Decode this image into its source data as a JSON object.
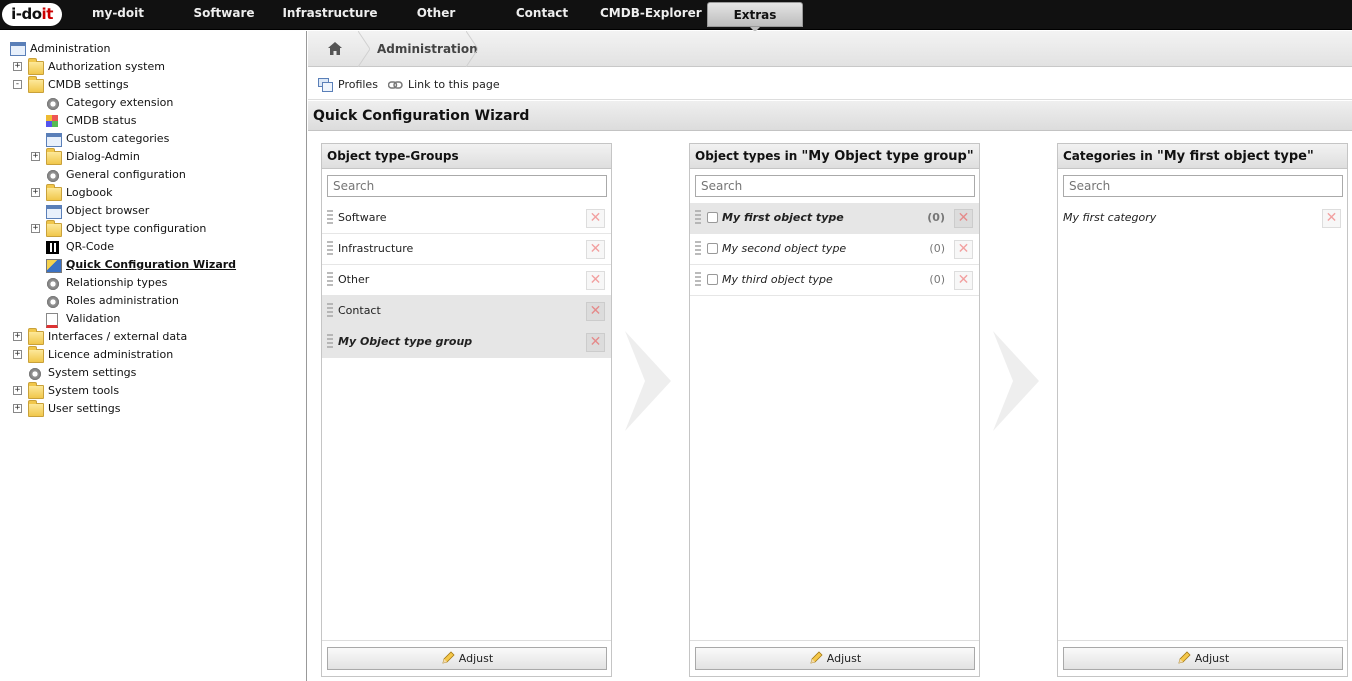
{
  "logo": {
    "text_main": "i-do",
    "text_accent": "it"
  },
  "topnav": {
    "items": [
      {
        "label": "my-doit"
      },
      {
        "label": "Software"
      },
      {
        "label": "Infrastructure"
      },
      {
        "label": "Other"
      },
      {
        "label": "Contact"
      },
      {
        "label": "CMDB-Explorer"
      },
      {
        "label": "Extras",
        "active": true
      }
    ]
  },
  "tree": {
    "root": "Administration",
    "nodes": [
      {
        "label": "Authorization system",
        "icon": "folder-icon",
        "expander": "+"
      },
      {
        "label": "CMDB settings",
        "icon": "folder-icon",
        "expander": "-"
      },
      {
        "label": "Category extension",
        "icon": "gear-icon"
      },
      {
        "label": "CMDB status",
        "icon": "grid-icon"
      },
      {
        "label": "Custom categories",
        "icon": "window-icon"
      },
      {
        "label": "Dialog-Admin",
        "icon": "folder-icon",
        "expander": "+"
      },
      {
        "label": "General configuration",
        "icon": "gear-icon"
      },
      {
        "label": "Logbook",
        "icon": "folder-icon",
        "expander": "+"
      },
      {
        "label": "Object browser",
        "icon": "window-icon"
      },
      {
        "label": "Object type configuration",
        "icon": "folder-icon",
        "expander": "+"
      },
      {
        "label": "QR-Code",
        "icon": "qr-icon"
      },
      {
        "label": "Quick Configuration Wizard",
        "icon": "wand-icon",
        "selected": true
      },
      {
        "label": "Relationship types",
        "icon": "gear-icon"
      },
      {
        "label": "Roles administration",
        "icon": "gear-icon"
      },
      {
        "label": "Validation",
        "icon": "doc-icon"
      },
      {
        "label": "Interfaces / external data",
        "icon": "folder-icon",
        "expander": "+"
      },
      {
        "label": "Licence administration",
        "icon": "folder-icon",
        "expander": "+"
      },
      {
        "label": "System settings",
        "icon": "gear-icon"
      },
      {
        "label": "System tools",
        "icon": "folder-icon",
        "expander": "+"
      },
      {
        "label": "User settings",
        "icon": "folder-icon",
        "expander": "+"
      }
    ]
  },
  "breadcrumb": {
    "home_icon": "home-icon",
    "current": "Administration"
  },
  "actions": {
    "profiles": "Profiles",
    "link": "Link to this page"
  },
  "page_title": "Quick Configuration Wizard",
  "columns": {
    "groups": {
      "title": "Object type-Groups",
      "search_placeholder": "Search",
      "items": [
        {
          "label": "Software"
        },
        {
          "label": "Infrastructure"
        },
        {
          "label": "Other"
        },
        {
          "label": "Contact",
          "highlighted": true
        },
        {
          "label": "My Object type group",
          "active": true
        }
      ],
      "adjust": "Adjust"
    },
    "types": {
      "title_prefix": "Object types in ",
      "title_quoted": "\"My Object type group\"",
      "search_placeholder": "Search",
      "items": [
        {
          "label": "My first object type",
          "count": "(0)",
          "active": true
        },
        {
          "label": "My second object type",
          "count": "(0)"
        },
        {
          "label": "My third object type",
          "count": "(0)"
        }
      ],
      "adjust": "Adjust"
    },
    "categories": {
      "title_prefix": "Categories in ",
      "title_quoted": "\"My first object type\"",
      "search_placeholder": "Search",
      "items": [
        {
          "label": "My first category"
        }
      ],
      "adjust": "Adjust"
    }
  },
  "delete_glyph": "✕"
}
